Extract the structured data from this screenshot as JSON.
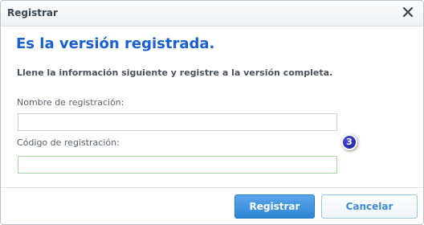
{
  "dialog": {
    "title": "Registrar",
    "close_icon": "close-icon"
  },
  "content": {
    "heading": "Es la versión registrada.",
    "instructions": "Llene la información siguiente y registre a la versión completa.",
    "name_label": "Nombre de registración:",
    "name_value": "",
    "code_label": "Código de registración:",
    "code_value": "",
    "callout_number": "3"
  },
  "footer": {
    "register_label": "Registrar",
    "cancel_label": "Cancelar"
  },
  "colors": {
    "heading": "#1a5fd1",
    "primary_button": "#2f86d6",
    "secondary_button_text": "#3f8ad0",
    "callout_badge": "#1a1e9a"
  }
}
